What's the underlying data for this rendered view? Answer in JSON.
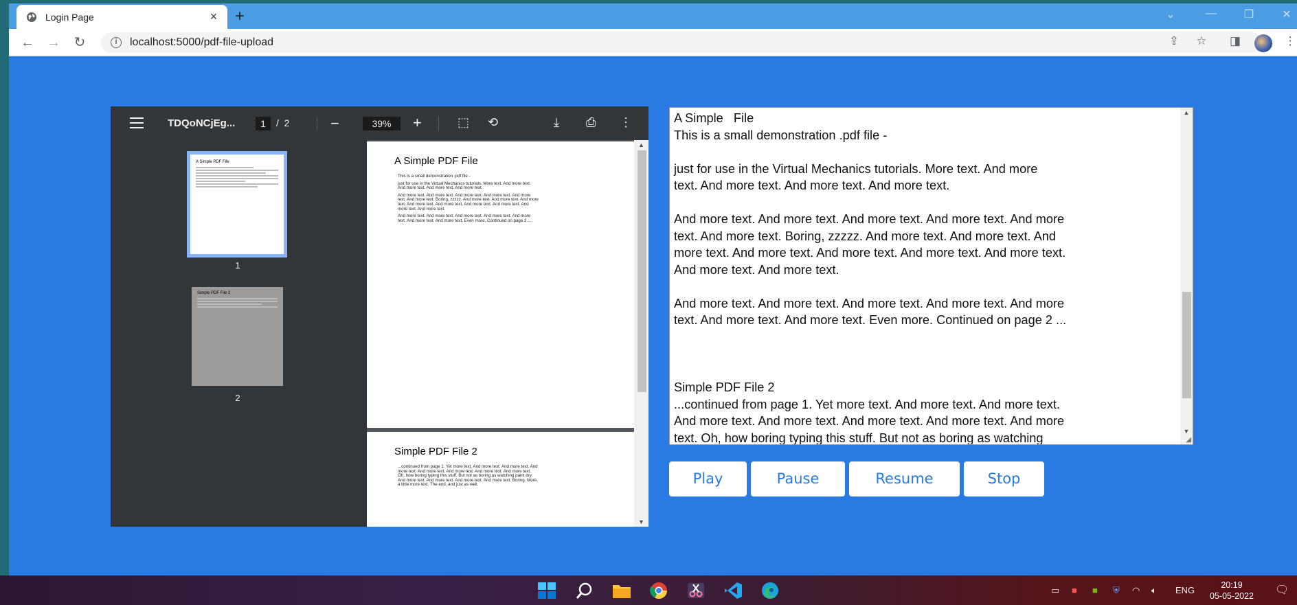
{
  "browser": {
    "tab_title": "Login Page",
    "tab_close": "×",
    "new_tab": "+",
    "url": "localhost:5000/pdf-file-upload"
  },
  "pdf_viewer": {
    "file_name": "TDQoNCjEg...",
    "current_page": "1",
    "page_separator": "/",
    "total_pages": "2",
    "zoom": "39%",
    "thumbnails": [
      {
        "label": "1",
        "title": "A Simple PDF File"
      },
      {
        "label": "2",
        "title": "Simple PDF File 2"
      }
    ],
    "pages": [
      {
        "title": "A Simple PDF File",
        "paragraphs": [
          "This is a small demonstration .pdf file -",
          "just for use in the Virtual Mechanics tutorials. More text. And more text. And more text. And more text. And more text.",
          "And more text. And more text. And more text. And more text. And more text. And more text. Boring, zzzzz. And more text. And more text. And more text. And more text. And more text. And more text. And more text. And more text. And more text.",
          "And more text. And more text. And more text. And more text. And more text. And more text. And more text. Even more. Continued on page 2 ..."
        ]
      },
      {
        "title": "Simple PDF File 2",
        "paragraphs": [
          "...continued from page 1. Yet more text. And more text. And more text. And more text. And more text. And more text. And more text. And more text. Oh, how boring typing this stuff. But not as boring as watching paint dry. And more text. And more text. And more text. And more text. Boring.  More, a little more text. The end, and just as well."
        ]
      }
    ]
  },
  "text_area": {
    "content": "A Simple   File\nThis is a small demonstration .pdf file -\n\njust for use in the Virtual Mechanics tutorials. More text. And more\ntext. And more text. And more text. And more text.\n\nAnd more text. And more text. And more text. And more text. And more\ntext. And more text. Boring, zzzzz. And more text. And more text. And\nmore text. And more text. And more text. And more text. And more text.\nAnd more text. And more text.\n\nAnd more text. And more text. And more text. And more text. And more\ntext. And more text. And more text. Even more. Continued on page 2 ...\n\n\n\nSimple PDF File 2\n...continued from page 1. Yet more text. And more text. And more text.\nAnd more text. And more text. And more text. And more text. And more\ntext. Oh, how boring typing this stuff. But not as boring as watching"
  },
  "controls": {
    "play": "Play",
    "pause": "Pause",
    "resume": "Resume",
    "stop": "Stop"
  },
  "taskbar": {
    "language": "ENG",
    "time": "20:19",
    "date": "05-05-2022"
  },
  "colors": {
    "page_background": "#2a7ae4",
    "tab_strip": "#4a9de3",
    "pdf_toolbar": "#323639",
    "button_text": "#2a7ae4"
  }
}
